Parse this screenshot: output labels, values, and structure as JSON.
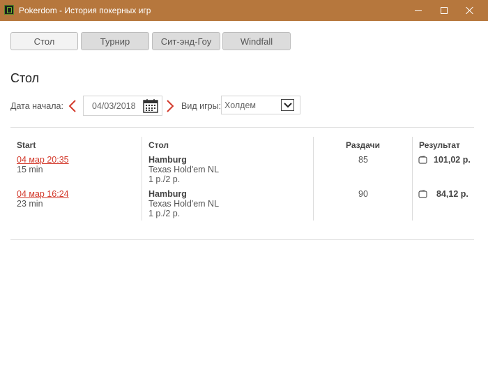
{
  "window": {
    "title": "Pokerdom - История покерных игр"
  },
  "tabs": [
    {
      "label": "Стол",
      "active": true
    },
    {
      "label": "Турнир",
      "active": false
    },
    {
      "label": "Сит-энд-Гоу",
      "active": false
    },
    {
      "label": "Windfall",
      "active": false
    }
  ],
  "section": {
    "title": "Стол"
  },
  "filters": {
    "date_label": "Дата начала:",
    "date_value": "04/03/2018",
    "game_label": "Вид игры:",
    "game_value": "Холдем"
  },
  "table": {
    "headers": {
      "start": "Start",
      "table": "Стол",
      "hands": "Раздачи",
      "result": "Результат"
    },
    "rows": [
      {
        "start": "04 мар 20:35",
        "duration": "15 min",
        "name": "Hamburg",
        "game": "Texas Hold'em NL",
        "stakes": "1 р./2 р.",
        "hands": "85",
        "result": "101,02 р."
      },
      {
        "start": "04 мар 16:24",
        "duration": "23 min",
        "name": "Hamburg",
        "game": "Texas Hold'em NL",
        "stakes": "1 р./2 р.",
        "hands": "90",
        "result": "84,12 р."
      }
    ]
  },
  "icons": {
    "app": "pokerdom-app-icon",
    "prev": "chevron-left-icon",
    "next": "chevron-right-icon",
    "calendar": "calendar-icon",
    "dropdown": "chevron-down-icon",
    "wallet": "wallet-icon"
  },
  "colors": {
    "titlebar": "#b6773d",
    "accent_red": "#d33a2c",
    "tab_bg": "#dcdcdc",
    "tab_active_bg": "#f3f3f3"
  }
}
